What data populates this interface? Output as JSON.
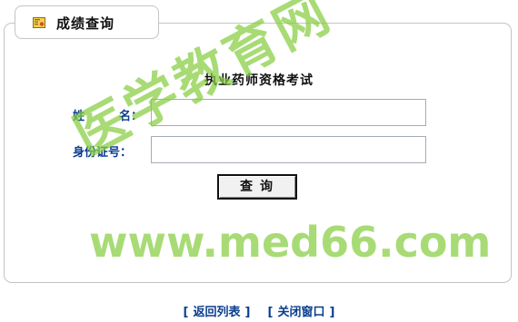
{
  "tab": {
    "icon": "certificate-icon",
    "title": "成绩查询"
  },
  "form": {
    "exam_title": "执业药师资格考试",
    "name_label": {
      "part1": "姓",
      "part2": "名："
    },
    "name_value": "",
    "id_label": "身份证号：",
    "id_value": "",
    "query_button": "查询"
  },
  "watermark": {
    "text": "医学教育网",
    "url": "www.med66.com"
  },
  "footer": {
    "back_list": "返回列表",
    "close_window": "关闭窗口"
  },
  "colors": {
    "label": "#0a3d8f",
    "watermark": "#86cd40",
    "border": "#c4c4c4"
  }
}
